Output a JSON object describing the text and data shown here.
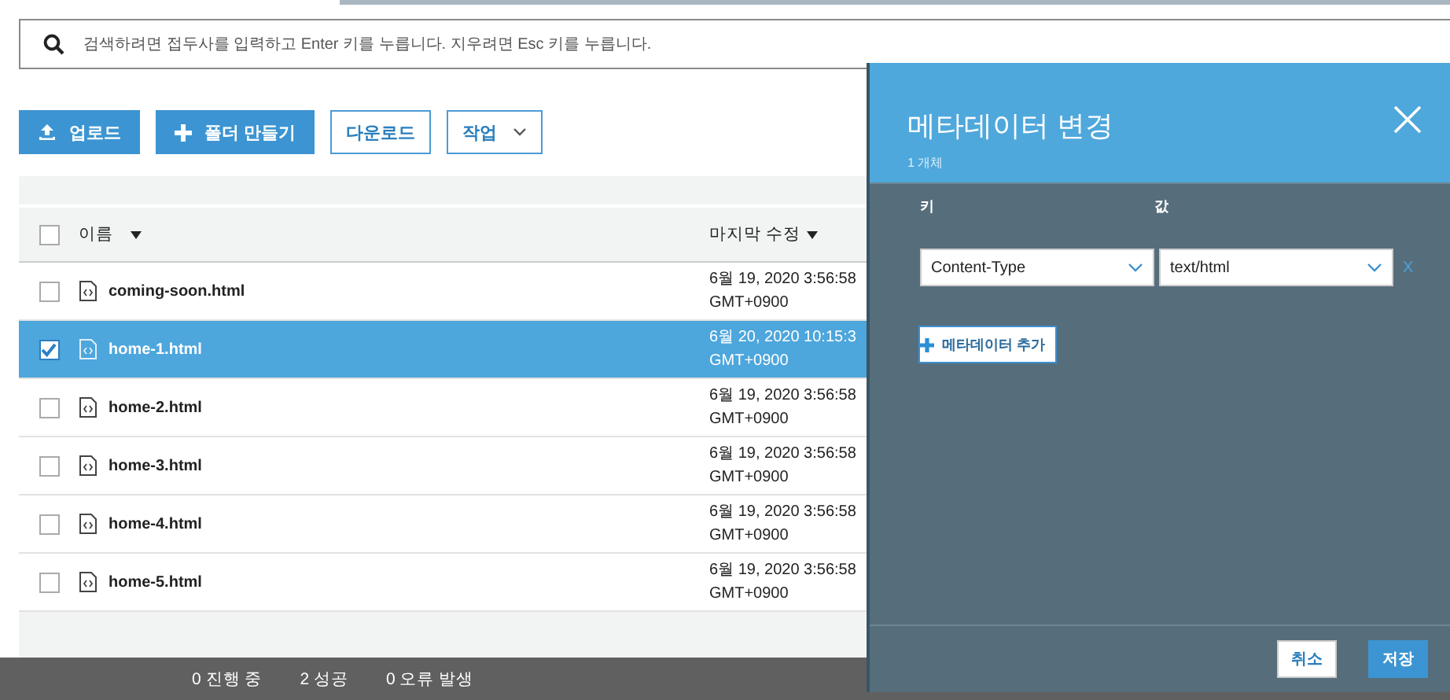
{
  "search": {
    "placeholder": "검색하려면 접두사를 입력하고 Enter 키를 누릅니다. 지우려면 Esc 키를 누릅니다."
  },
  "toolbar": [
    {
      "label": "업로드",
      "kind": "upload"
    },
    {
      "label": "폴더 만들기",
      "kind": "folder"
    },
    {
      "label": "다운로드",
      "kind": "outline"
    },
    {
      "label": "작업",
      "kind": "dropdown"
    }
  ],
  "table": {
    "select_all": {
      "checked": false
    },
    "columns": [
      "이름",
      "마지막 수정"
    ],
    "rows": [
      {
        "name": "coming-soon.html",
        "modified": [
          "6월 19, 2020 3:56:58",
          "GMT+0900"
        ],
        "selected": false
      },
      {
        "name": "home-1.html",
        "modified": [
          "6월 20, 2020 10:15:3",
          "GMT+0900"
        ],
        "selected": true
      },
      {
        "name": "home-2.html",
        "modified": [
          "6월 19, 2020 3:56:58",
          "GMT+0900"
        ],
        "selected": false
      },
      {
        "name": "home-3.html",
        "modified": [
          "6월 19, 2020 3:56:58",
          "GMT+0900"
        ],
        "selected": false
      },
      {
        "name": "home-4.html",
        "modified": [
          "6월 19, 2020 3:56:58",
          "GMT+0900"
        ],
        "selected": false
      },
      {
        "name": "home-5.html",
        "modified": [
          "6월 19, 2020 3:56:58",
          "GMT+0900"
        ],
        "selected": false
      }
    ]
  },
  "status_bar": [
    "0 진행 중",
    "2 성공",
    "0 오류 발생"
  ],
  "dialog": {
    "title": "메타데이터 변경",
    "subtitle": "1 개체",
    "key_label": "키",
    "value_label": "값",
    "entries": [
      {
        "key": "Content-Type",
        "value": "text/html",
        "remove": "X"
      }
    ],
    "add_button": "메타데이터 추가",
    "buttons": [
      {
        "label": "취소",
        "kind": "secondary"
      },
      {
        "label": "저장",
        "kind": "primary"
      }
    ]
  }
}
